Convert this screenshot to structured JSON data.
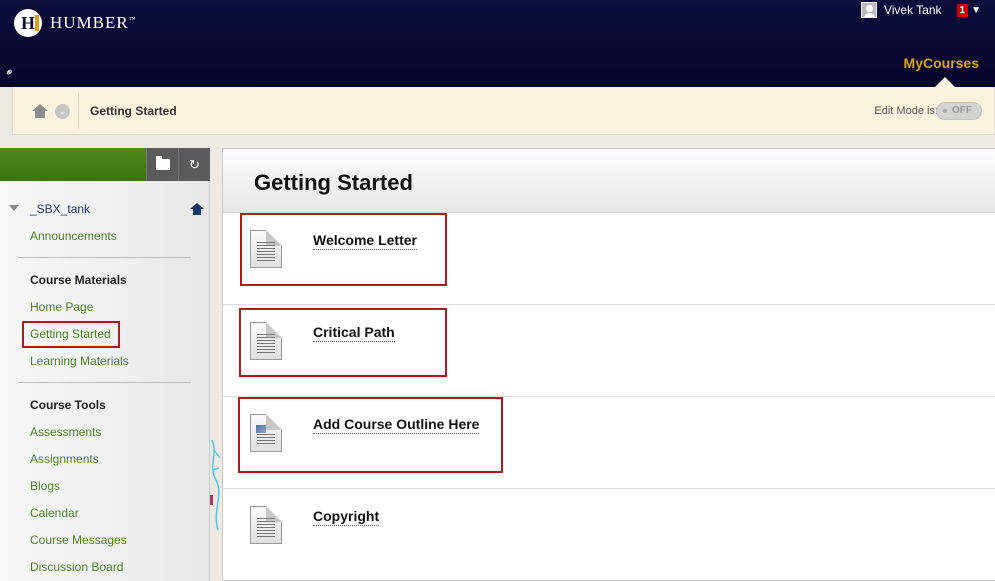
{
  "header": {
    "logo_text": "HUMBER",
    "logo_letter": "H",
    "user_name": "Vivek Tank",
    "notification_count": "1",
    "nav_tab": "MyCourses"
  },
  "breadcrumb": {
    "current": "Getting Started",
    "edit_mode_label": "Edit Mode is:",
    "edit_mode_value": "OFF"
  },
  "course_menu": {
    "course_name": "_SBX_tank",
    "top_links": [
      "Announcements"
    ],
    "sections": [
      {
        "heading": "Course Materials",
        "items": [
          "Home Page",
          "Getting Started",
          "Learning Materials"
        ]
      },
      {
        "heading": "Course Tools",
        "items": [
          "Assessments",
          "Assignments",
          "Blogs",
          "Calendar",
          "Course Messages",
          "Discussion Board"
        ]
      }
    ],
    "selected": "Getting Started"
  },
  "content": {
    "title": "Getting Started",
    "items": [
      {
        "title": "Welcome Letter",
        "icon": "document-icon",
        "highlighted": true
      },
      {
        "title": "Critical Path",
        "icon": "document-icon",
        "highlighted": true
      },
      {
        "title": "Add Course Outline Here",
        "icon": "document-image-icon",
        "highlighted": true
      },
      {
        "title": "Copyright",
        "icon": "document-icon",
        "highlighted": false
      }
    ]
  },
  "colors": {
    "header_bg": "#0d0d3c",
    "accent_gold": "#d4a514",
    "menu_link_green": "#4a8224",
    "highlight_red": "#b01a1a",
    "breadcrumb_bg": "#fcf3de"
  }
}
